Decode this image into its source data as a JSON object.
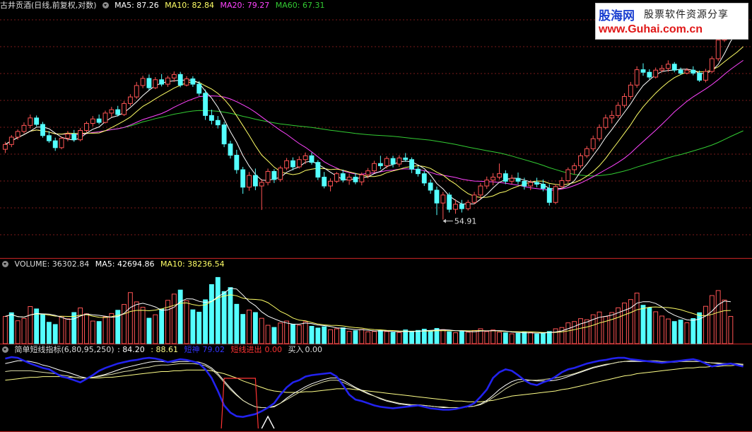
{
  "colors": {
    "up": "#ff5454",
    "down": "#54ffff",
    "panel_border": "#b02020",
    "grid": "#7a1a1a",
    "ma5": "#ffffff",
    "ma10": "#ffff66",
    "ma20": "#ff44ff",
    "ma60": "#33cc33",
    "kdj_fast": "#2222ee",
    "kdj_slow": "#ffffff",
    "kdj_avg": "#ffff88",
    "signal": "#ff3333"
  },
  "price_header": {
    "title": "古井贡酒(日线,前复权,对数)",
    "ma5": "MA5: 87.26",
    "ma10": "MA10: 82.84",
    "ma20": "MA20: 79.27",
    "ma60": "MA60: 67.31"
  },
  "volume_header": {
    "title": "VOLUME: 36302.84",
    "ma5": "MA5: 42694.86",
    "ma10": "MA10: 38236.54"
  },
  "indicator_header": {
    "title": "简单短线指标(6,80,95,250)",
    "v1": ": 84.20",
    "v2": ": 88.61",
    "v3_label": "短神",
    "v3": "79.02",
    "v4_label": "短线进出",
    "v4": "0.00",
    "v5_label": "买入",
    "v5": "0.00"
  },
  "low_annotation": "54.91",
  "watermark": {
    "line1": "股海网",
    "line2": "股票软件资源分享",
    "line3": "www.Guhai.com.cn"
  },
  "chart_data": {
    "type": "candlestick",
    "scale": "log",
    "price_range": [
      50,
      97
    ],
    "candles": [
      [
        66.8,
        68.2,
        66.1,
        67.7
      ],
      [
        67.7,
        69.5,
        67.2,
        69.1
      ],
      [
        69.1,
        70.6,
        68.6,
        70.2
      ],
      [
        70.2,
        72.0,
        69.8,
        71.4
      ],
      [
        71.4,
        73.6,
        70.8,
        72.9
      ],
      [
        72.9,
        73.4,
        71.2,
        71.6
      ],
      [
        71.6,
        72.1,
        69.0,
        69.4
      ],
      [
        69.4,
        70.3,
        68.0,
        68.4
      ],
      [
        68.4,
        69.0,
        66.5,
        67.1
      ],
      [
        67.1,
        69.2,
        66.8,
        68.9
      ],
      [
        68.9,
        70.3,
        68.3,
        69.7
      ],
      [
        69.7,
        70.5,
        68.2,
        68.6
      ],
      [
        68.6,
        70.9,
        68.3,
        70.4
      ],
      [
        70.4,
        72.2,
        70.0,
        71.8
      ],
      [
        71.8,
        73.3,
        71.2,
        72.7
      ],
      [
        72.7,
        73.6,
        71.6,
        72.0
      ],
      [
        72.0,
        74.4,
        71.8,
        73.9
      ],
      [
        73.9,
        75.2,
        73.1,
        74.6
      ],
      [
        74.6,
        75.4,
        73.2,
        73.6
      ],
      [
        73.6,
        76.4,
        73.3,
        75.9
      ],
      [
        75.9,
        77.9,
        75.4,
        77.3
      ],
      [
        77.3,
        80.6,
        76.9,
        79.8
      ],
      [
        79.8,
        82.0,
        79.2,
        81.4
      ],
      [
        81.4,
        82.3,
        78.8,
        79.3
      ],
      [
        79.3,
        81.7,
        79.0,
        81.1
      ],
      [
        81.1,
        82.4,
        79.6,
        80.1
      ],
      [
        80.1,
        82.0,
        79.5,
        81.5
      ],
      [
        81.5,
        83.0,
        80.6,
        82.3
      ],
      [
        82.3,
        82.9,
        79.4,
        79.9
      ],
      [
        79.9,
        81.9,
        79.6,
        81.3
      ],
      [
        81.3,
        81.9,
        79.5,
        80.1
      ],
      [
        80.1,
        80.8,
        77.5,
        78.1
      ],
      [
        78.1,
        78.9,
        72.5,
        73.4
      ],
      [
        73.4,
        74.6,
        71.6,
        72.4
      ],
      [
        72.4,
        73.3,
        70.8,
        71.5
      ],
      [
        71.5,
        72.1,
        67.2,
        67.8
      ],
      [
        67.8,
        68.4,
        65.1,
        65.7
      ],
      [
        65.7,
        66.7,
        62.4,
        63.1
      ],
      [
        63.1,
        63.6,
        59.0,
        60.1
      ],
      [
        60.1,
        62.7,
        59.5,
        62.1
      ],
      [
        62.1,
        63.3,
        59.6,
        60.3
      ],
      [
        60.3,
        61.5,
        56.4,
        60.9
      ],
      [
        60.9,
        63.3,
        60.4,
        62.8
      ],
      [
        62.8,
        63.2,
        60.8,
        61.4
      ],
      [
        61.4,
        63.8,
        61.0,
        63.4
      ],
      [
        63.4,
        65.2,
        63.0,
        64.7
      ],
      [
        64.7,
        65.3,
        63.0,
        63.6
      ],
      [
        63.6,
        65.5,
        63.3,
        64.9
      ],
      [
        64.9,
        66.2,
        64.1,
        65.6
      ],
      [
        65.6,
        66.2,
        64.0,
        64.4
      ],
      [
        64.4,
        64.8,
        61.3,
        61.8
      ],
      [
        61.8,
        62.7,
        59.9,
        60.3
      ],
      [
        60.3,
        61.6,
        59.4,
        61.1
      ],
      [
        61.1,
        62.7,
        60.8,
        62.4
      ],
      [
        62.4,
        63.1,
        60.9,
        61.3
      ],
      [
        61.3,
        62.4,
        60.5,
        61.8
      ],
      [
        61.8,
        62.5,
        60.6,
        61.0
      ],
      [
        61.0,
        62.6,
        60.4,
        62.2
      ],
      [
        62.2,
        63.4,
        61.6,
        62.9
      ],
      [
        62.9,
        64.7,
        62.5,
        64.2
      ],
      [
        64.2,
        65.6,
        63.2,
        63.8
      ],
      [
        63.8,
        65.5,
        63.3,
        65.1
      ],
      [
        65.1,
        65.6,
        63.5,
        64.1
      ],
      [
        64.1,
        65.7,
        63.6,
        65.2
      ],
      [
        65.2,
        66.1,
        64.5,
        64.9
      ],
      [
        64.9,
        65.3,
        62.5,
        63.2
      ],
      [
        63.2,
        63.7,
        61.9,
        62.4
      ],
      [
        62.4,
        62.9,
        60.3,
        60.8
      ],
      [
        60.8,
        61.4,
        59.0,
        59.6
      ],
      [
        59.6,
        60.2,
        55.6,
        57.5
      ],
      [
        57.5,
        59.3,
        54.9,
        58.8
      ],
      [
        58.8,
        59.2,
        56.0,
        56.5
      ],
      [
        56.5,
        58.1,
        55.8,
        57.3
      ],
      [
        57.3,
        58.0,
        56.0,
        56.6
      ],
      [
        56.6,
        58.0,
        56.3,
        57.6
      ],
      [
        57.6,
        59.3,
        57.3,
        58.8
      ],
      [
        58.8,
        60.8,
        58.2,
        60.3
      ],
      [
        60.3,
        61.9,
        59.8,
        61.3
      ],
      [
        61.3,
        62.5,
        60.4,
        61.8
      ],
      [
        61.8,
        64.2,
        61.4,
        62.4
      ],
      [
        62.4,
        63.0,
        60.6,
        61.1
      ],
      [
        61.1,
        62.2,
        60.6,
        61.6
      ],
      [
        61.6,
        62.6,
        60.6,
        61.1
      ],
      [
        61.1,
        61.7,
        59.7,
        60.3
      ],
      [
        60.3,
        61.3,
        59.6,
        60.9
      ],
      [
        60.9,
        61.7,
        60.1,
        60.6
      ],
      [
        60.6,
        61.4,
        59.4,
        59.9
      ],
      [
        59.9,
        60.6,
        57.1,
        57.6
      ],
      [
        57.6,
        60.6,
        57.3,
        60.2
      ],
      [
        60.2,
        61.8,
        59.8,
        61.2
      ],
      [
        61.2,
        63.5,
        60.8,
        63.1
      ],
      [
        63.1,
        64.3,
        62.3,
        63.8
      ],
      [
        63.8,
        66.1,
        63.4,
        65.6
      ],
      [
        65.6,
        67.4,
        65.2,
        66.9
      ],
      [
        66.9,
        69.4,
        66.4,
        68.8
      ],
      [
        68.8,
        71.6,
        68.3,
        71.0
      ],
      [
        71.0,
        73.6,
        70.6,
        72.9
      ],
      [
        72.9,
        74.4,
        71.8,
        73.4
      ],
      [
        73.4,
        76.2,
        72.9,
        75.5
      ],
      [
        75.5,
        78.1,
        75.0,
        77.4
      ],
      [
        77.4,
        80.6,
        76.8,
        79.9
      ],
      [
        79.9,
        84.2,
        79.3,
        83.4
      ],
      [
        83.4,
        84.9,
        82.0,
        82.8
      ],
      [
        82.8,
        83.5,
        81.2,
        81.7
      ],
      [
        81.7,
        83.9,
        81.4,
        83.3
      ],
      [
        83.3,
        84.5,
        82.8,
        83.7
      ],
      [
        83.7,
        85.6,
        82.9,
        84.7
      ],
      [
        84.7,
        85.2,
        82.8,
        83.3
      ],
      [
        83.3,
        83.9,
        82.2,
        82.6
      ],
      [
        82.6,
        83.8,
        82.3,
        83.3
      ],
      [
        83.3,
        84.2,
        82.1,
        82.6
      ],
      [
        82.6,
        83.2,
        80.6,
        81.0
      ],
      [
        81.0,
        83.6,
        80.5,
        83.0
      ],
      [
        83.0,
        86.6,
        82.6,
        86.0
      ],
      [
        86.0,
        91.6,
        85.4,
        90.6
      ],
      [
        90.6,
        96.4,
        90.1,
        95.5
      ],
      [
        95.5,
        97.1,
        94.7,
        96.4
      ],
      [
        96.4,
        97.3,
        93.9,
        94.6
      ],
      [
        94.6,
        97.2,
        93.5,
        96.3
      ]
    ],
    "volume_range": [
      0,
      100000
    ],
    "volume": [
      36302,
      41208,
      30511,
      33620,
      49504,
      46312,
      38617,
      28504,
      25530,
      36221,
      33111,
      41502,
      47617,
      39805,
      30122,
      29516,
      35813,
      40201,
      44517,
      52308,
      68116,
      55712,
      48517,
      33909,
      38501,
      46212,
      57818,
      66105,
      71503,
      57204,
      45117,
      42013,
      58505,
      78808,
      88312,
      69516,
      74811,
      52509,
      39002,
      44815,
      41507,
      33811,
      24503,
      21612,
      27504,
      30113,
      26003,
      24512,
      29208,
      23105,
      20803,
      22511,
      18604,
      19817,
      21110,
      16502,
      17203,
      18804,
      15808,
      16217,
      17504,
      16118,
      15016,
      14813,
      18305,
      16204,
      17612,
      19317,
      16911,
      20308,
      18703,
      15815,
      14514,
      16117,
      15312,
      17504,
      19819,
      16116,
      18221,
      15208,
      14506,
      13105,
      13818,
      15504,
      14817,
      12906,
      14312,
      16205,
      19818,
      21506,
      27717,
      29512,
      33315,
      31908,
      38512,
      42217,
      36111,
      41502,
      47815,
      54211,
      58802,
      67504,
      51212,
      47815,
      42506,
      36804,
      32913,
      29511,
      31503,
      27818,
      33507,
      41209,
      49813,
      64105,
      70816,
      58204,
      36302
    ],
    "volume_upcolors": [
      1,
      0,
      1,
      1,
      1,
      0,
      0,
      0,
      0,
      1,
      1,
      0,
      1,
      1,
      1,
      0,
      1,
      1,
      0,
      1,
      1,
      1,
      1,
      0,
      1,
      0,
      1,
      1,
      0,
      1,
      0,
      0,
      0,
      0,
      0,
      0,
      0,
      0,
      0,
      1,
      0,
      1,
      1,
      0,
      1,
      1,
      0,
      1,
      1,
      0,
      0,
      0,
      1,
      1,
      0,
      1,
      0,
      1,
      1,
      1,
      0,
      1,
      0,
      1,
      0,
      0,
      0,
      0,
      0,
      0,
      1,
      0,
      1,
      0,
      1,
      1,
      1,
      1,
      1,
      1,
      0,
      1,
      0,
      0,
      1,
      0,
      0,
      0,
      1,
      1,
      1,
      1,
      1,
      1,
      1,
      1,
      1,
      1,
      1,
      1,
      1,
      1,
      0,
      0,
      1,
      1,
      1,
      0,
      0,
      1,
      0,
      0,
      1,
      1,
      1,
      1,
      1,
      0,
      1
    ],
    "indicator_range": [
      0,
      100
    ],
    "kdj_fast": [
      95,
      97,
      96,
      92,
      88,
      85,
      82,
      80,
      75,
      70,
      68,
      65,
      62,
      67,
      72,
      78,
      82,
      85,
      88,
      90,
      92,
      93,
      95,
      96,
      95,
      93,
      90,
      92,
      94,
      93,
      91,
      88,
      80,
      68,
      50,
      30,
      20,
      15,
      14,
      16,
      18,
      22,
      27,
      33,
      45,
      55,
      62,
      65,
      70,
      72,
      73,
      74,
      75,
      70,
      58,
      45,
      38,
      36,
      33,
      30,
      28,
      27,
      26,
      27,
      28,
      29,
      30,
      28,
      26,
      25,
      24,
      24,
      25,
      27,
      29,
      33,
      42,
      52,
      68,
      76,
      80,
      78,
      72,
      65,
      60,
      58,
      62,
      65,
      70,
      76,
      80,
      82,
      85,
      88,
      90,
      92,
      93,
      95,
      96,
      96,
      94,
      93,
      92,
      91,
      90,
      89,
      90,
      91,
      92,
      93,
      94,
      92,
      88,
      84,
      86,
      87,
      88,
      86,
      84
    ],
    "kdj_slow": [
      88,
      90,
      92,
      92,
      91,
      89,
      86,
      84,
      81,
      78,
      76,
      73,
      70,
      68,
      69,
      71,
      73,
      76,
      79,
      82,
      84,
      86,
      88,
      90,
      91,
      91,
      90,
      90,
      91,
      91,
      91,
      90,
      87,
      82,
      74,
      64,
      54,
      45,
      37,
      32,
      28,
      27,
      27,
      28,
      33,
      40,
      46,
      51,
      56,
      60,
      63,
      66,
      68,
      68,
      65,
      60,
      55,
      51,
      47,
      43,
      39,
      36,
      34,
      32,
      31,
      30,
      30,
      30,
      29,
      28,
      27,
      27,
      27,
      27,
      28,
      29,
      32,
      37,
      44,
      52,
      58,
      63,
      66,
      66,
      65,
      64,
      64,
      64,
      65,
      67,
      70,
      73,
      76,
      79,
      82,
      84,
      86,
      88,
      90,
      91,
      91,
      91,
      91,
      91,
      90,
      90,
      90,
      90,
      91,
      91,
      91,
      91,
      90,
      89,
      88,
      88,
      88,
      87,
      87
    ],
    "kdj_avg": [
      65,
      66,
      67,
      68,
      69,
      69,
      70,
      70,
      70,
      70,
      69,
      69,
      68,
      68,
      68,
      68,
      69,
      69,
      70,
      71,
      72,
      73,
      74,
      75,
      76,
      77,
      77,
      78,
      78,
      79,
      79,
      79,
      79,
      78,
      76,
      74,
      71,
      68,
      64,
      61,
      58,
      55,
      52,
      50,
      49,
      48,
      48,
      48,
      49,
      49,
      50,
      51,
      52,
      53,
      53,
      53,
      52,
      51,
      50,
      49,
      48,
      47,
      46,
      45,
      44,
      43,
      42,
      41,
      40,
      39,
      38,
      37,
      36,
      36,
      35,
      35,
      35,
      36,
      37,
      39,
      41,
      43,
      44,
      45,
      46,
      47,
      48,
      49,
      50,
      52,
      53,
      55,
      57,
      59,
      61,
      63,
      65,
      67,
      69,
      71,
      72,
      74,
      75,
      76,
      77,
      78,
      79,
      80,
      81,
      82,
      82,
      83,
      83,
      84,
      84,
      85,
      85,
      86,
      86
    ],
    "kdj_short": [
      77,
      78,
      78,
      78,
      78,
      77,
      76,
      75,
      74,
      72,
      71,
      69,
      68,
      68,
      69,
      70,
      72,
      73,
      75,
      77,
      78,
      80,
      82,
      83,
      85,
      86,
      86,
      87,
      88,
      88,
      88,
      87,
      85,
      80,
      72,
      62,
      52,
      44,
      37,
      32,
      28,
      27,
      27,
      29,
      33,
      38,
      43,
      48,
      53,
      57,
      60,
      63,
      65,
      65,
      62,
      58,
      54,
      50,
      46,
      43,
      40,
      37,
      35,
      33,
      32,
      31,
      31,
      30,
      29,
      28,
      28,
      27,
      27,
      27,
      28,
      29,
      31,
      35,
      41,
      47,
      53,
      58,
      62,
      64,
      65,
      65,
      66,
      67,
      68,
      70,
      72,
      74,
      77,
      80,
      83,
      85,
      87,
      88,
      90,
      91,
      92,
      92,
      92,
      92,
      92,
      91,
      91,
      91,
      91,
      91,
      91,
      91,
      90,
      89,
      89,
      88,
      88,
      88,
      87
    ],
    "signal_box": [
      35,
      40
    ],
    "signal_tri": [
      41,
      43
    ]
  }
}
